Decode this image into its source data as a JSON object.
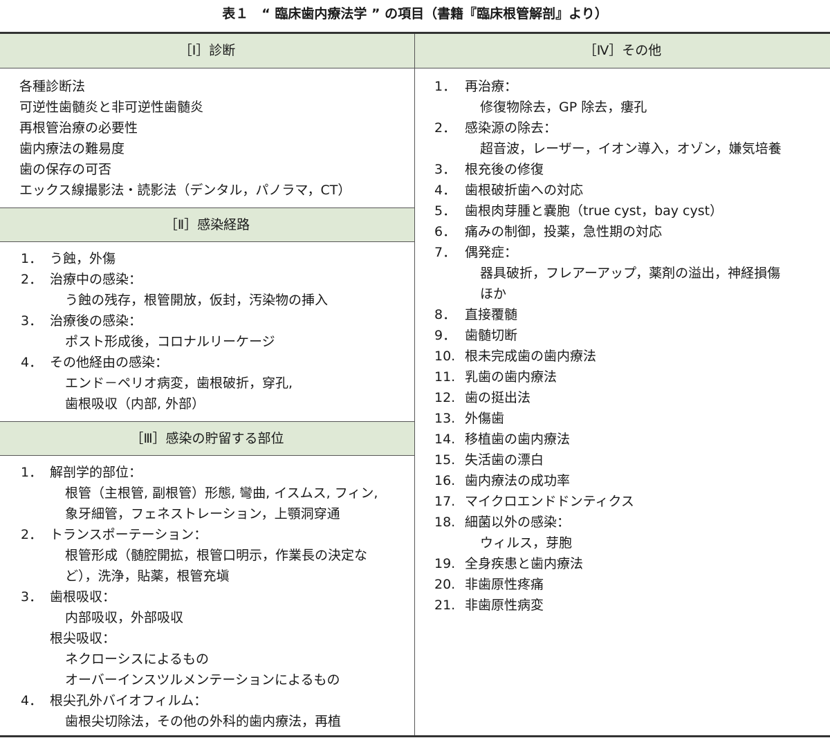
{
  "caption": "表１　“ 臨床歯内療法学 ” の項目（書籍『臨床根管解剖』より）",
  "section1": {
    "title": "［Ⅰ］診断",
    "lines": [
      "各種診断法",
      "可逆性歯髄炎と非可逆性歯髄炎",
      "再根管治療の必要性",
      "歯内療法の難易度",
      "歯の保存の可否",
      "エックス線撮影法・読影法（デンタル，パノラマ，CT）"
    ]
  },
  "section2": {
    "title": "［Ⅱ］感染経路",
    "items": [
      {
        "num": "1．",
        "label": "う蝕，外傷",
        "sub": []
      },
      {
        "num": "2．",
        "label": "治療中の感染：",
        "sub": [
          "う蝕の残存，根管開放，仮封，汚染物の挿入"
        ]
      },
      {
        "num": "3．",
        "label": "治療後の感染：",
        "sub": [
          "ポスト形成後，コロナルリーケージ"
        ]
      },
      {
        "num": "4．",
        "label": "その他経由の感染：",
        "sub": [
          "エンド－ペリオ病変，歯根破折，穿孔,",
          "歯根吸収（内部, 外部）"
        ]
      }
    ]
  },
  "section3": {
    "title": "［Ⅲ］感染の貯留する部位",
    "items": [
      {
        "num": "1．",
        "label": "解剖学的部位：",
        "sub": [
          "根管（主根管, 副根管）形態, 彎曲, イスムス, フィン,",
          "象牙細管，フェネストレーション，上顎洞穿通"
        ]
      },
      {
        "num": "2．",
        "label": "トランスポーテーション：",
        "sub": [
          "根管形成（髄腔開拡，根管口明示，作業長の決定な",
          "ど），洗浄，貼薬，根管充塡"
        ]
      },
      {
        "num": "3．",
        "label": "歯根吸収：",
        "sub": [
          "内部吸収，外部吸収"
        ]
      },
      {
        "num": "",
        "label": "根尖吸収：",
        "sub": [
          "ネクローシスによるもの",
          "オーバーインスツルメンテーションによるもの"
        ]
      },
      {
        "num": "4．",
        "label": "根尖孔外バイオフィルム：",
        "sub": [
          "歯根尖切除法，その他の外科的歯内療法，再植"
        ]
      }
    ]
  },
  "section4": {
    "title": "［Ⅳ］その他",
    "items": [
      {
        "num": "1．",
        "label": "再治療：",
        "sub": [
          "修復物除去，GP 除去，瘻孔"
        ]
      },
      {
        "num": "2．",
        "label": "感染源の除去：",
        "sub": [
          "超音波，レーザー，イオン導入，オゾン，嫌気培養"
        ]
      },
      {
        "num": "3．",
        "label": "根充後の修復",
        "sub": []
      },
      {
        "num": "4．",
        "label": "歯根破折歯への対応",
        "sub": []
      },
      {
        "num": "5．",
        "label": "歯根肉芽腫と嚢胞（true cyst，bay cyst）",
        "sub": []
      },
      {
        "num": "6．",
        "label": "痛みの制御，投薬，急性期の対応",
        "sub": []
      },
      {
        "num": "7．",
        "label": "偶発症：",
        "sub": [
          "器具破折，フレアーアップ，薬剤の溢出，神経損傷",
          "ほか"
        ]
      },
      {
        "num": "8．",
        "label": "直接覆髄",
        "sub": []
      },
      {
        "num": "9．",
        "label": "歯髄切断",
        "sub": []
      },
      {
        "num": "10.",
        "label": "根未完成歯の歯内療法",
        "sub": []
      },
      {
        "num": "11.",
        "label": "乳歯の歯内療法",
        "sub": []
      },
      {
        "num": "12.",
        "label": "歯の挺出法",
        "sub": []
      },
      {
        "num": "13.",
        "label": "外傷歯",
        "sub": []
      },
      {
        "num": "14.",
        "label": "移植歯の歯内療法",
        "sub": []
      },
      {
        "num": "15.",
        "label": "失活歯の漂白",
        "sub": []
      },
      {
        "num": "16.",
        "label": "歯内療法の成功率",
        "sub": []
      },
      {
        "num": "17.",
        "label": "マイクロエンドドンティクス",
        "sub": []
      },
      {
        "num": "18.",
        "label": "細菌以外の感染：",
        "sub": [
          "ウィルス，芽胞"
        ]
      },
      {
        "num": "19.",
        "label": "全身疾患と歯内療法",
        "sub": []
      },
      {
        "num": "20.",
        "label": "非歯原性疼痛",
        "sub": []
      },
      {
        "num": "21.",
        "label": "非歯原性病変",
        "sub": []
      }
    ]
  }
}
